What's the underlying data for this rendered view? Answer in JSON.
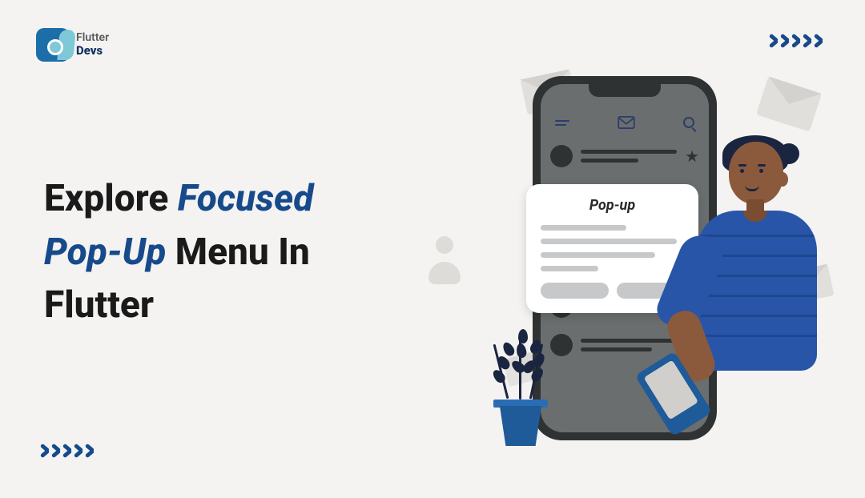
{
  "logo": {
    "top": "Flutter",
    "bottom": "Devs"
  },
  "title": {
    "w1": "Explore ",
    "w2": "Focused",
    "w3": "Pop-Up",
    "w4": " Menu In",
    "w5": "Flutter"
  },
  "popup": {
    "label": "Pop-up"
  }
}
